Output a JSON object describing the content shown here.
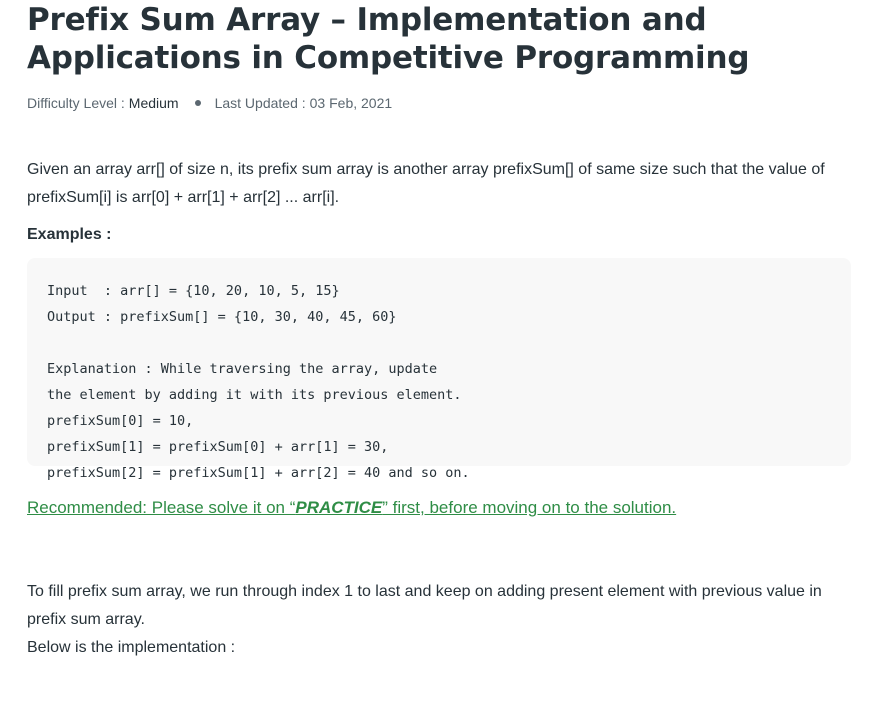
{
  "article": {
    "title": "Prefix Sum Array – Implementation and Applications in Competitive Programming",
    "meta": {
      "difficulty_label": "Difficulty Level :",
      "difficulty_value": "Medium",
      "updated_label": "Last Updated :",
      "updated_value": "03 Feb, 2021"
    },
    "intro": "Given an array arr[] of size n, its prefix sum array is another array prefixSum[] of same size such that the value of prefixSum[i] is arr[0] + arr[1] + arr[2] ... arr[i].",
    "examples_heading": "Examples :",
    "example_code": "Input  : arr[] = {10, 20, 10, 5, 15}\nOutput : prefixSum[] = {10, 30, 40, 45, 60}\n\nExplanation : While traversing the array, update \nthe element by adding it with its previous element.\nprefixSum[0] = 10, \nprefixSum[1] = prefixSum[0] + arr[1] = 30, \nprefixSum[2] = prefixSum[1] + arr[2] = 40 and so on.",
    "recommended": {
      "prefix": "Recommended: Please solve it on “",
      "practice": "PRACTICE",
      "suffix": "” first, before moving on to the solution."
    },
    "paragraph1": "To fill prefix sum array, we run through index 1 to last and keep on adding present element with previous value in prefix sum array.",
    "paragraph2": "Below is the implementation :"
  },
  "colors": {
    "text": "#273239",
    "muted": "#5b6770",
    "link_green": "#2f8d46",
    "code_bg": "#f8f8f8"
  }
}
